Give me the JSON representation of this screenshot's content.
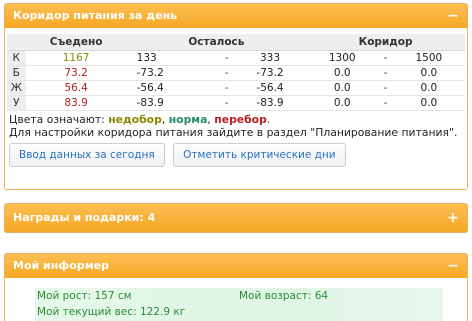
{
  "corridor_panel": {
    "title": "Коридор питания за день",
    "toggle_symbol": "−",
    "headers": {
      "eaten": "Съедено",
      "remaining": "Осталось",
      "corridor": "Коридор"
    },
    "rows": [
      {
        "label": "К",
        "eaten": "1167",
        "eaten_color": "green",
        "rem_from": "133",
        "rem_to": "333",
        "cor_from": "1300",
        "cor_to": "1500"
      },
      {
        "label": "Б",
        "eaten": "73.2",
        "eaten_color": "red",
        "rem_from": "-73.2",
        "rem_to": "-73.2",
        "cor_from": "0.0",
        "cor_to": "0.0"
      },
      {
        "label": "Ж",
        "eaten": "56.4",
        "eaten_color": "red",
        "rem_from": "-56.4",
        "rem_to": "-56.4",
        "cor_from": "0.0",
        "cor_to": "0.0"
      },
      {
        "label": "У",
        "eaten": "83.9",
        "eaten_color": "red",
        "rem_from": "-83.9",
        "rem_to": "-83.9",
        "cor_from": "0.0",
        "cor_to": "0.0"
      }
    ],
    "dash": "-",
    "legend_prefix": "Цвета означают: ",
    "legend_under": "недобор",
    "legend_norm": "норма",
    "legend_over": "перебор",
    "legend_sep": ", ",
    "legend_end": ".",
    "info_text": "Для настройки коридора питания зайдите в раздел \"Планирование питания\".",
    "btn_today": "Ввод данных за сегодня",
    "btn_critical": "Отметить критические дни"
  },
  "rewards_panel": {
    "title": "Награды и подарки: 4",
    "toggle_symbol": "+"
  },
  "informer_panel": {
    "title": "Мой информер",
    "toggle_symbol": "−",
    "height_text": "Мой рост: 157 см",
    "age_text": "Мой возраст: 64",
    "weight_text": "Мой текущий вес: 122.9 кг"
  },
  "colors": {
    "header_orange": "#f5a623",
    "under": "#8a8a00",
    "norm": "#2a8c66",
    "over": "#b32020",
    "link": "#2a6fbf"
  }
}
